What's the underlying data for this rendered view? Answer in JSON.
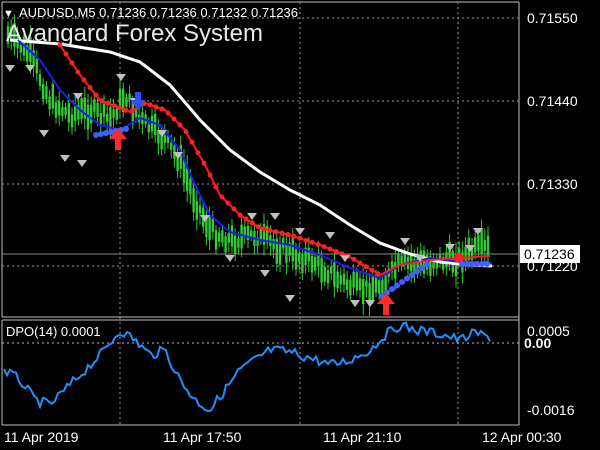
{
  "header": {
    "symbol_info": "AUDUSD,M5  0.71236 0.71236 0.71232 0.71236",
    "watermark": "Avangard Forex System"
  },
  "main_chart": {
    "price_labels": [
      "0.71550",
      "0.71440",
      "0.71330",
      "0.71220"
    ],
    "current_price": "0.71236",
    "price_range": [
      0.7117,
      0.7157
    ]
  },
  "indicator": {
    "label": "DPO(14) 0.0001",
    "levels": [
      "0.0005",
      "0.00",
      "-0.0016"
    ]
  },
  "time_axis": [
    "11 Apr 2019",
    "11 Apr 17:50",
    "11 Apr 21:10",
    "12 Apr 00:30"
  ],
  "colors": {
    "background": "#000000",
    "grid": "#c0c0c0",
    "bull_candle": "#33cc33",
    "white_ma": "#ffffff",
    "blue_line": "#1a1aff",
    "red_line": "#ff1a1a",
    "red_dots": "#ff2020",
    "blue_dots": "#4060ff",
    "dpo_line": "#1e90ff",
    "arrow_marks": "#c0c0c0"
  },
  "icons": [
    "triangle-down-icon",
    "arrow-up-icon",
    "arrow-down-icon"
  ]
}
